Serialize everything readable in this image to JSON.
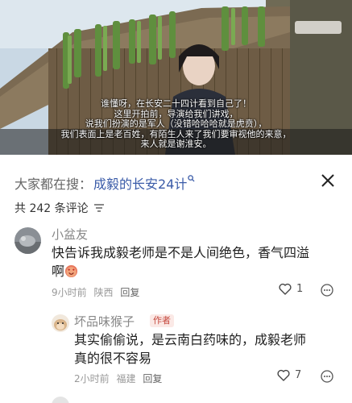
{
  "video": {
    "subtitles": [
      "谁懂呀，在长安二十四计看到自己了！",
      "这里开拍前，导演给我们讲戏，",
      "说我们扮演的是军人（没错哈哈哈就是虎贲），",
      "我们表面上是老百姓，有陌生人来了我们要审视他的来意，",
      "来人就是谢淮安。"
    ]
  },
  "header": {
    "search_prefix": "大家都在搜：",
    "search_term": "成毅的长安24计",
    "comment_count": "共 242 条评论"
  },
  "comments": [
    {
      "username": "小盆友",
      "text_line1": "快告诉我成毅老师是不是人间绝色，香气四溢",
      "text_line2": "啊",
      "time": "9小时前",
      "location": "陕西",
      "reply_label": "回复",
      "likes": "1"
    },
    {
      "username": "坏品味猴子",
      "badge": "作者",
      "text_line1": "其实偷偷说，是云南白药味的，成毅老师",
      "text_line2": "真的很不容易",
      "time": "2小时前",
      "location": "福建",
      "reply_label": "回复",
      "likes": "7"
    }
  ],
  "colors": {
    "search_term": "#3a5ba8",
    "author_badge": "#c4483d"
  }
}
